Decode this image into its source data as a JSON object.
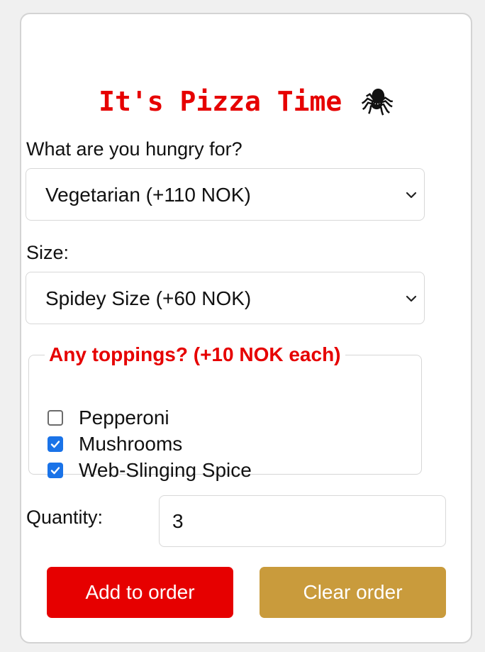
{
  "header": {
    "title": "It's Pizza Time",
    "icon": "spider-icon",
    "icon_glyph": "🕷"
  },
  "pizza": {
    "label": "What are you hungry for?",
    "selected": "Vegetarian (+110 NOK)"
  },
  "size": {
    "label": "Size:",
    "selected": "Spidey Size (+60 NOK)"
  },
  "toppings": {
    "legend": "Any toppings? (+10 NOK each)",
    "items": [
      {
        "label": "Pepperoni",
        "checked": false
      },
      {
        "label": "Mushrooms",
        "checked": true
      },
      {
        "label": "Web-Slinging Spice",
        "checked": true
      }
    ]
  },
  "quantity": {
    "label": "Quantity:",
    "value": "3"
  },
  "actions": {
    "add_label": "Add to order",
    "clear_label": "Clear order"
  },
  "colors": {
    "accent_red": "#e60000",
    "accent_gold": "#c99b3c",
    "checkbox_blue": "#1a73e8"
  }
}
